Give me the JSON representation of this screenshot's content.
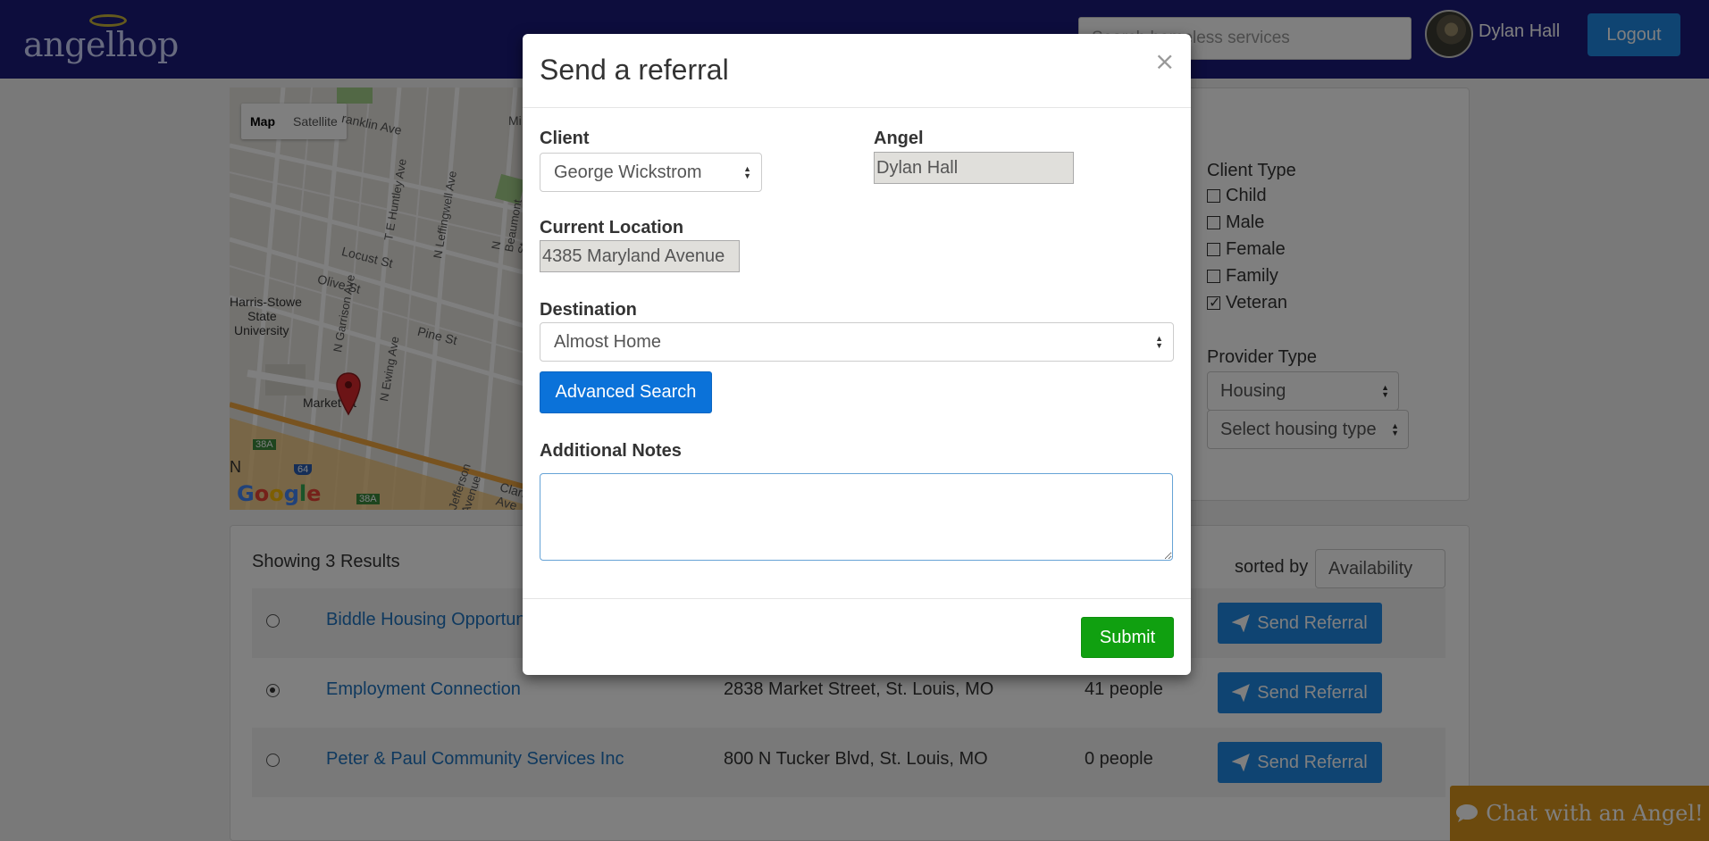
{
  "navbar": {
    "logo_text": "angelhop",
    "search_placeholder": "Search homeless services",
    "user_name": "Dylan Hall",
    "logout_label": "Logout"
  },
  "map": {
    "type_options": [
      "Map",
      "Satellite"
    ],
    "selected_type": "Map",
    "street_labels": [
      "ranklin Ave",
      "T E Huntley Ave",
      "N Leffingwell Ave",
      "N Beaumont St",
      "N Garrison Ave",
      "Locust St",
      "Olive St",
      "Harris-Stowe",
      "State",
      "University",
      "N Ewing Ave",
      "Pine St",
      "Market St",
      "Jefferson Avenue",
      "Clark Ave",
      "38A",
      "64",
      "N",
      "Mi"
    ],
    "attribution": "Google"
  },
  "filters": {
    "client_type_label": "Client Type",
    "client_types": [
      {
        "label": "Child",
        "checked": false
      },
      {
        "label": "Male",
        "checked": false
      },
      {
        "label": "Female",
        "checked": false
      },
      {
        "label": "Family",
        "checked": false
      },
      {
        "label": "Veteran",
        "checked": true
      }
    ],
    "provider_type_label": "Provider Type",
    "provider_type_value": "Housing",
    "housing_type_value": "Select housing type"
  },
  "results": {
    "showing_text": "Showing 3 Results",
    "sorted_by_label": "sorted by",
    "sort_value": "Availability",
    "send_label": "Send Referral",
    "rows": [
      {
        "name": "Biddle Housing Opportunities",
        "address": "",
        "capacity": "",
        "selected": false
      },
      {
        "name": "Employment Connection",
        "address": "2838 Market Street, St. Louis, MO",
        "capacity": "41 people",
        "selected": true
      },
      {
        "name": "Peter & Paul Community Services Inc",
        "address": "800 N Tucker Blvd, St. Louis, MO",
        "capacity": "0 people",
        "selected": false
      }
    ]
  },
  "chat": {
    "label": "Chat with an Angel!"
  },
  "modal": {
    "title": "Send a referral",
    "close_symbol": "×",
    "client_label": "Client",
    "client_value": "George Wickstrom",
    "angel_label": "Angel",
    "angel_value": "Dylan Hall",
    "location_label": "Current Location",
    "location_value": "4385 Maryland Avenue",
    "destination_label": "Destination",
    "destination_value": "Almost Home",
    "advanced_search_label": "Advanced Search",
    "notes_label": "Additional Notes",
    "notes_value": "",
    "submit_label": "Submit"
  },
  "colors": {
    "navbar": "#1a1a7a",
    "primary": "#1e88e5",
    "submit": "#10a010",
    "chat": "#d9951c",
    "link": "#1e73be"
  },
  "icons": [
    "paper-plane-icon",
    "comment-icon",
    "map-marker-icon",
    "close-icon",
    "select-arrows-icon"
  ]
}
